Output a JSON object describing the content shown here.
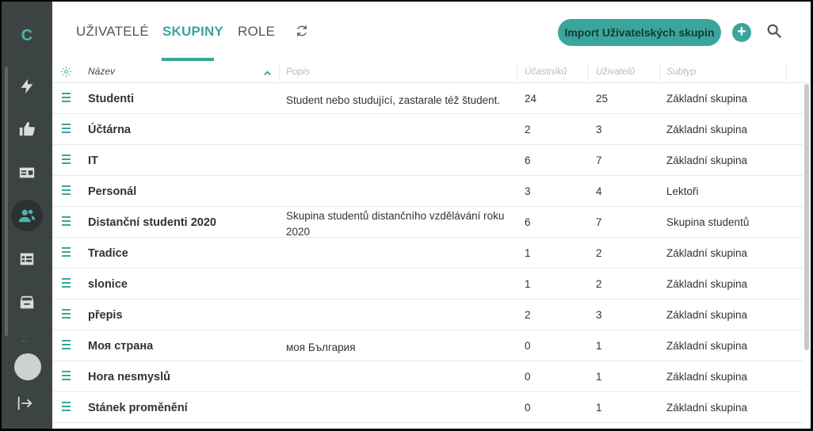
{
  "app": {
    "logo": "C"
  },
  "sidebar": {
    "items": [
      {
        "icon": "bolt-icon"
      },
      {
        "icon": "thumbs-up-icon"
      },
      {
        "icon": "id-card-icon"
      },
      {
        "icon": "users-icon",
        "active": true
      },
      {
        "icon": "table-icon"
      },
      {
        "icon": "archive-icon"
      }
    ],
    "logout_icon": "logout-icon"
  },
  "header": {
    "tabs": [
      {
        "label": "UŽIVATELÉ"
      },
      {
        "label": "SKUPINY"
      },
      {
        "label": "ROLE"
      }
    ],
    "import_label": "Import Uživatelských skupin",
    "add_label": "+",
    "accent": "#3aa69b"
  },
  "table": {
    "columns": {
      "name": "Název",
      "description": "Popis",
      "participants": "Účastníků",
      "users": "Uživatelů",
      "subtype": "Subtyp"
    },
    "rows": [
      {
        "name": "Studenti",
        "description": "Student nebo studující, zastarale též študent.",
        "participants": "24",
        "users": "25",
        "subtype": "Základní skupina"
      },
      {
        "name": "Účtárna",
        "description": "",
        "participants": "2",
        "users": "3",
        "subtype": "Základní skupina"
      },
      {
        "name": "IT",
        "description": "",
        "participants": "6",
        "users": "7",
        "subtype": "Základní skupina"
      },
      {
        "name": "Personál",
        "description": "",
        "participants": "3",
        "users": "4",
        "subtype": "Lektoři"
      },
      {
        "name": "Distanční studenti 2020",
        "description": "Skupina studentů distančního vzdělávání roku 2020",
        "participants": "6",
        "users": "7",
        "subtype": "Skupina studentů"
      },
      {
        "name": "Tradice",
        "description": "",
        "participants": "1",
        "users": "2",
        "subtype": "Základní skupina"
      },
      {
        "name": "slonice",
        "description": "",
        "participants": "1",
        "users": "2",
        "subtype": "Základní skupina"
      },
      {
        "name": "přepis",
        "description": "",
        "participants": "2",
        "users": "3",
        "subtype": "Základní skupina"
      },
      {
        "name": "Моя страна",
        "description": "моя България",
        "participants": "0",
        "users": "1",
        "subtype": "Základní skupina"
      },
      {
        "name": "Hora nesmyslů",
        "description": "",
        "participants": "0",
        "users": "1",
        "subtype": "Základní skupina"
      },
      {
        "name": "Stánek proměnění",
        "description": "",
        "participants": "0",
        "users": "1",
        "subtype": "Základní skupina"
      }
    ]
  }
}
